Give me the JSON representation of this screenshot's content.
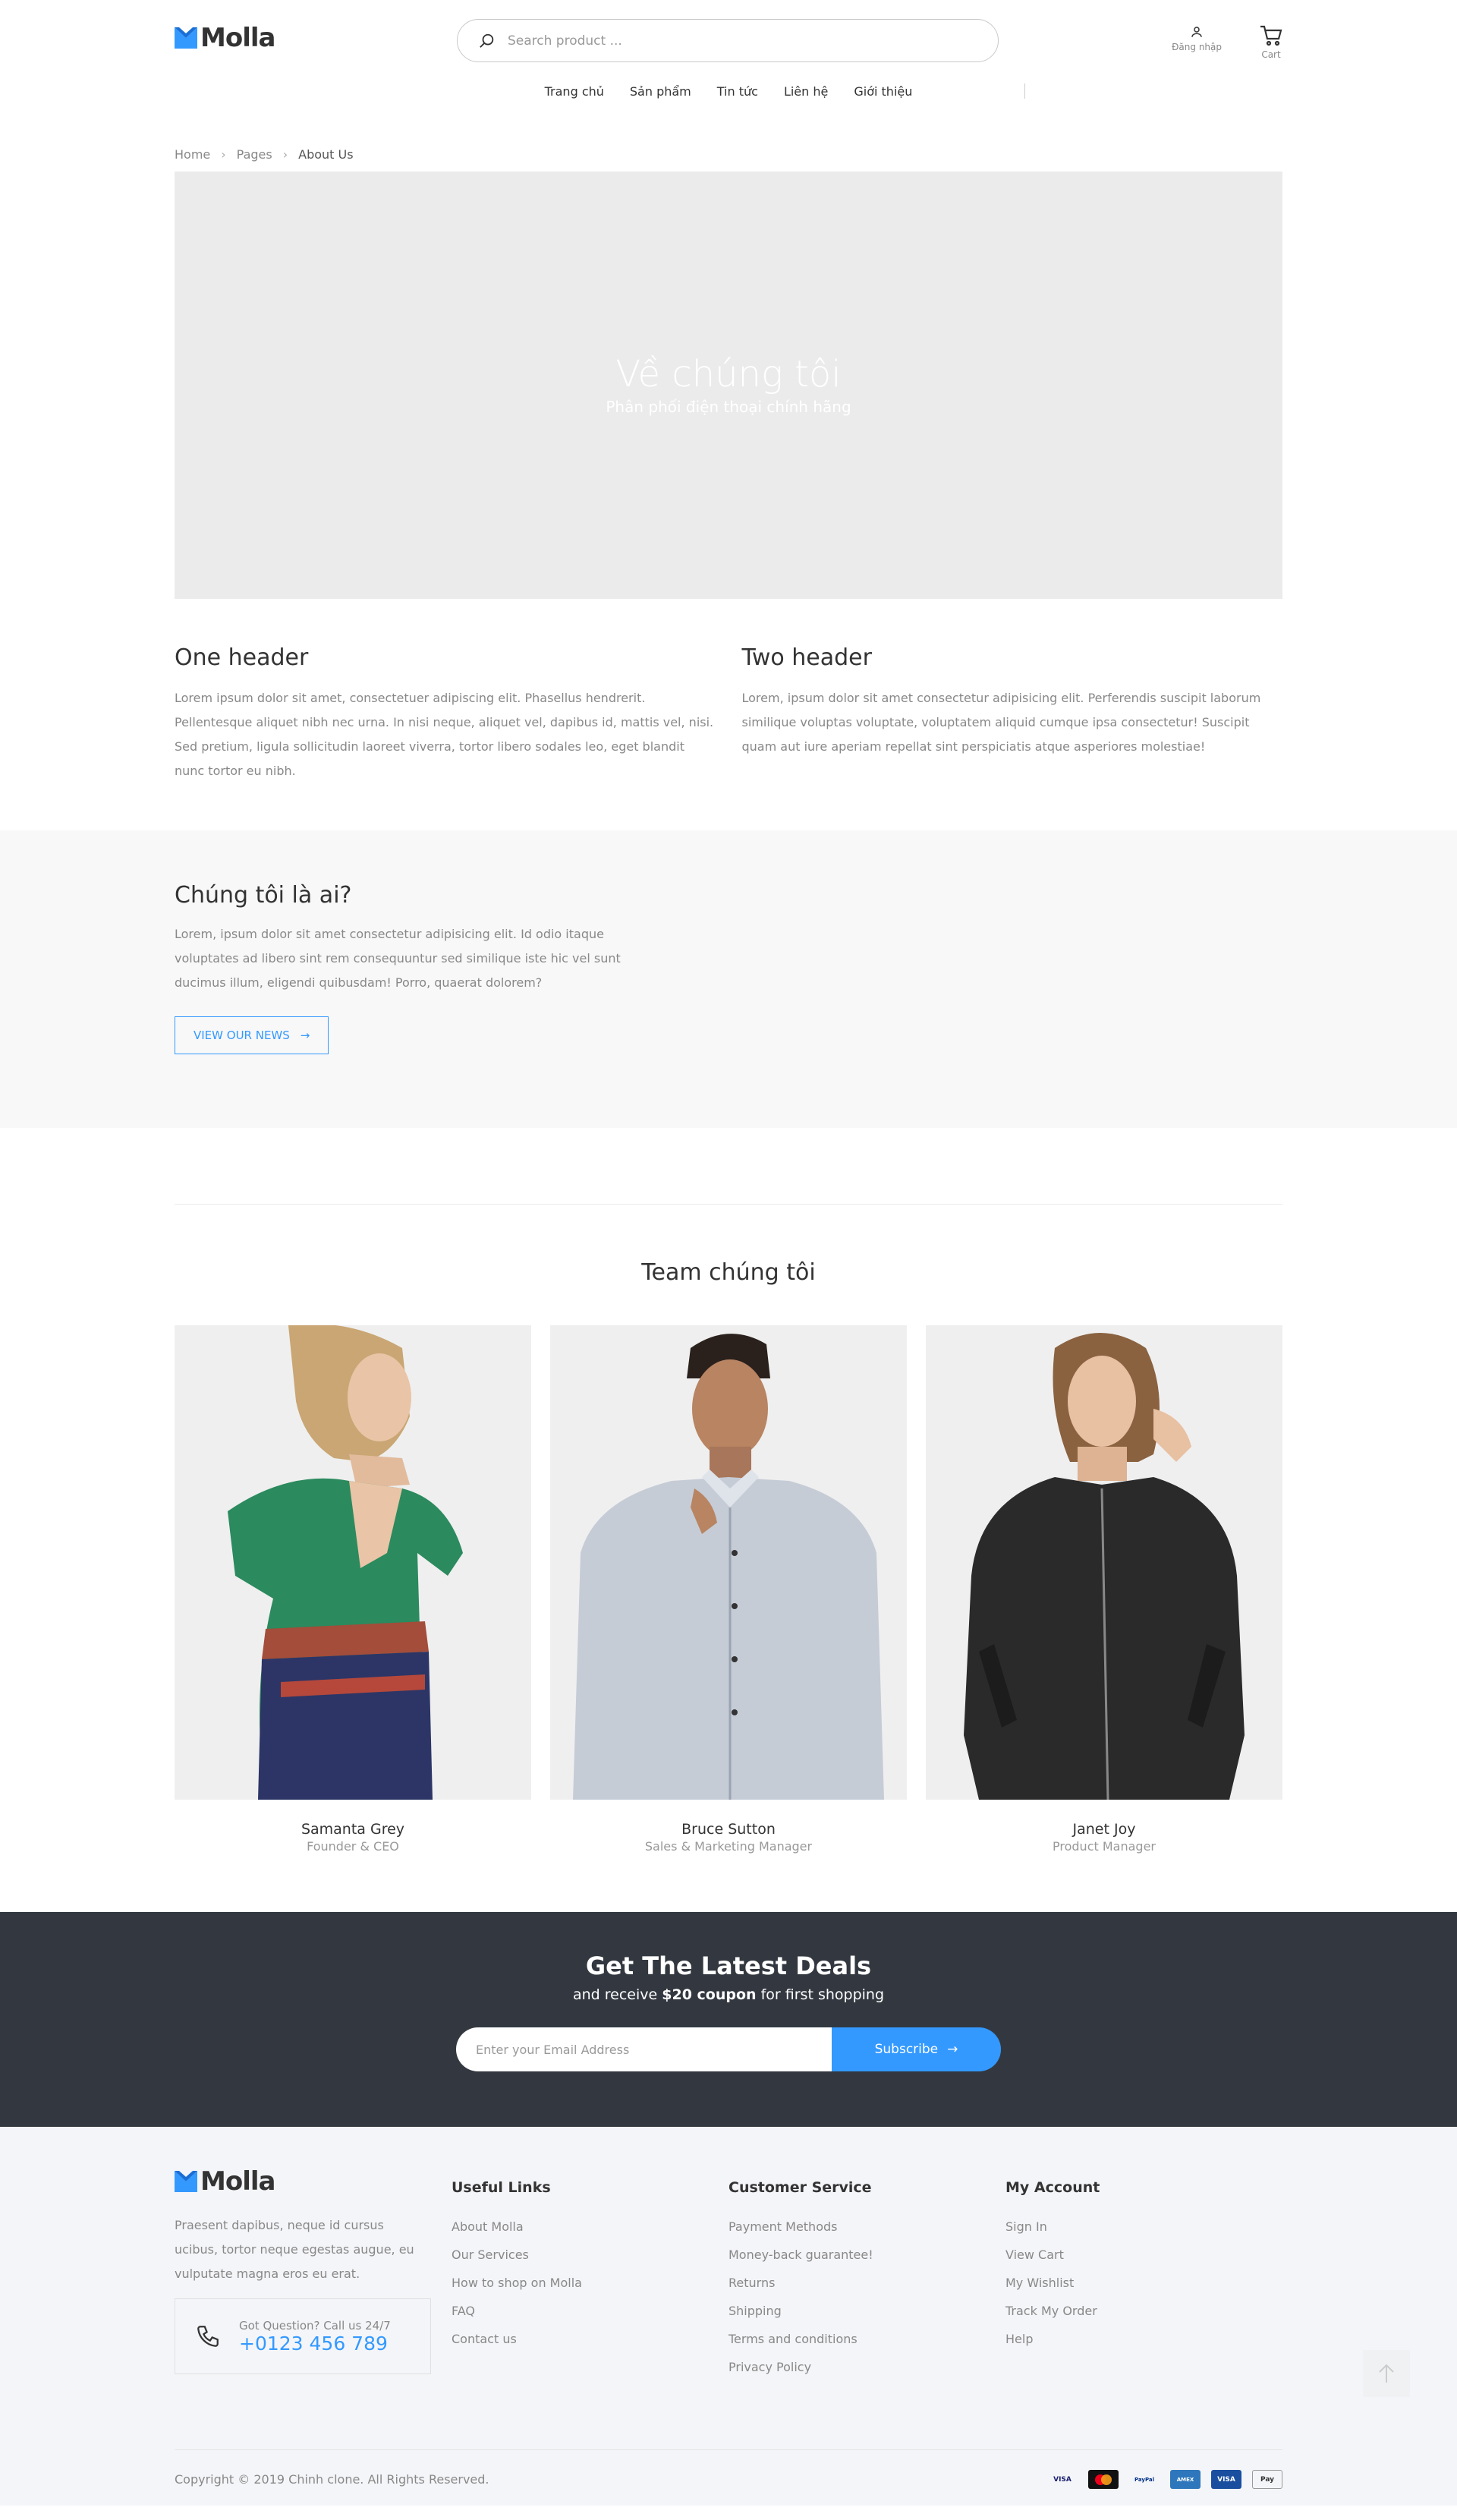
{
  "header": {
    "logo_text": "Molla",
    "search_placeholder": "Search product ...",
    "login_label": "Đăng nhập",
    "cart_label": "Cart"
  },
  "nav": {
    "items": [
      {
        "label": "Trang chủ"
      },
      {
        "label": "Sản phẩm"
      },
      {
        "label": "Tin tức"
      },
      {
        "label": "Liên hệ"
      },
      {
        "label": "Giới thiệu"
      }
    ]
  },
  "breadcrumb": {
    "home": "Home",
    "pages": "Pages",
    "current": "About Us"
  },
  "hero": {
    "title": "Về chúng tôi",
    "subtitle": "Phân phối điện thoại chính hãng"
  },
  "sections": {
    "one": {
      "title": "One header",
      "text": "Lorem ipsum dolor sit amet, consectetuer adipiscing elit. Phasellus hendrerit. Pellentesque aliquet nibh nec urna. In nisi neque, aliquet vel, dapibus id, mattis vel, nisi. Sed pretium, ligula sollicitudin laoreet viverra, tortor libero sodales leo, eget blandit nunc tortor eu nibh."
    },
    "two": {
      "title": "Two header",
      "text": "Lorem, ipsum dolor sit amet consectetur adipisicing elit. Perferendis suscipit laborum similique voluptas voluptate, voluptatem aliquid cumque ipsa consectetur! Suscipit quam aut iure aperiam repellat sint perspiciatis atque asperiores molestiae!"
    }
  },
  "who": {
    "title": "Chúng tôi là ai?",
    "text": "Lorem, ipsum dolor sit amet consectetur adipisicing elit. Id odio itaque voluptates ad libero sint rem consequuntur sed similique iste hic vel sunt ducimus illum, eligendi quibusdam! Porro, quaerat dolorem?",
    "button": "VIEW OUR NEWS"
  },
  "team": {
    "title": "Team chúng tôi",
    "members": [
      {
        "name": "Samanta Grey",
        "role": "Founder & CEO"
      },
      {
        "name": "Bruce Sutton",
        "role": "Sales & Marketing Manager"
      },
      {
        "name": "Janet Joy",
        "role": "Product Manager"
      }
    ]
  },
  "newsletter": {
    "title": "Get The Latest Deals",
    "text_before": "and receive",
    "text_strong": "$20 coupon",
    "text_after": "for first shopping",
    "placeholder": "Enter your Email Address",
    "button": "Subscribe"
  },
  "footer": {
    "logo_text": "Molla",
    "about": "Praesent dapibus, neque id cursus ucibus, tortor neque egestas augue, eu vulputate magna eros eu erat.",
    "phone_label": "Got Question? Call us 24/7",
    "phone": "+0123 456 789",
    "useful_links": {
      "title": "Useful Links",
      "items": [
        "About Molla",
        "Our Services",
        "How to shop on Molla",
        "FAQ",
        "Contact us"
      ]
    },
    "customer_service": {
      "title": "Customer Service",
      "items": [
        "Payment Methods",
        "Money-back guarantee!",
        "Returns",
        "Shipping",
        "Terms and conditions",
        "Privacy Policy"
      ]
    },
    "my_account": {
      "title": "My Account",
      "items": [
        "Sign In",
        "View Cart",
        "My Wishlist",
        "Track My Order",
        "Help"
      ]
    },
    "copyright": "Copyright © 2019 Chinh clone. All Rights Reserved.",
    "payments": [
      "VISA",
      "mastercard",
      "PayPal",
      "AMEX",
      "VISA",
      "Pay"
    ]
  },
  "colors": {
    "accent": "#3399ff",
    "dark_band": "#333840",
    "footer_bg": "#f4f5f8"
  }
}
